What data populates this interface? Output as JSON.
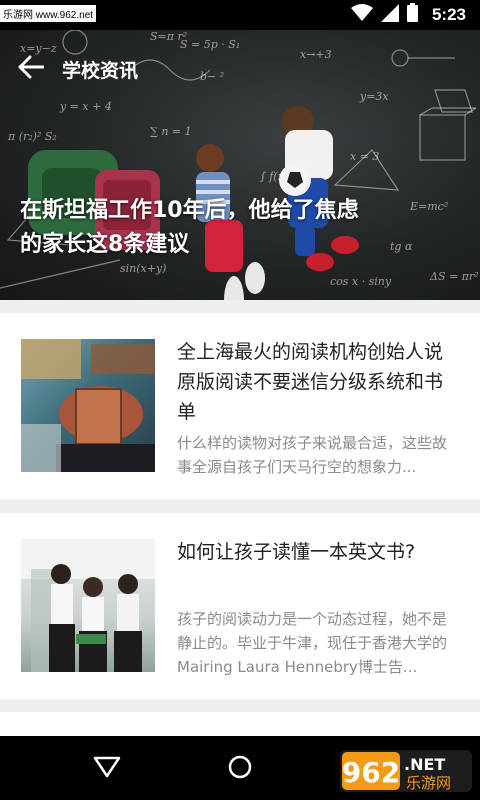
{
  "status_bar": {
    "watermark": "乐游网 www.962.net",
    "time": "5:23",
    "icons": [
      "wifi-icon",
      "signal-icon",
      "battery-icon"
    ]
  },
  "header": {
    "title": "学校资讯",
    "back_icon": "arrow-left-icon"
  },
  "banner": {
    "headline_line1": "在斯坦福工作10年后，他给了焦虑",
    "headline_line2": "的家长这8条建议",
    "chalk_texts": [
      "S=π r²",
      "x→+3",
      "b− ²",
      "y=3x",
      "x=y−z",
      "y = x + 4",
      "∑ n = 1",
      "x = 3",
      "E=mc²",
      "tg α",
      "sin(x+y)",
      "cos x · siny",
      "S = 5p · S₁",
      "∫ f(x)dx",
      "π (r₂)² S₂",
      "ΔS = πr²"
    ],
    "slide_count": 3,
    "active_slide": 1
  },
  "articles": [
    {
      "title": "全上海最火的阅读机构创始人说原版阅读不要迷信分级系统和书单",
      "summary": "什么样的读物对孩子来说最合适，这些故事全源自孩子们天马行空的想象力..."
    },
    {
      "title": "如何让孩子读懂一本英文书?",
      "summary": "孩子的阅读动力是一个动态过程，她不是静止的。毕业于牛津，现任于香港大学的Mairing Laura Hennebry博士告..."
    }
  ],
  "nav_bar": {
    "buttons": [
      "back-triangle-icon",
      "home-circle-icon"
    ],
    "watermark_digits": "962",
    "watermark_suffix": ".NET",
    "watermark_cn": "乐游网"
  },
  "colors": {
    "accent_orange": "#f39a16",
    "text_dark": "#222222",
    "text_gray": "#8a8a8a",
    "background": "#efefef"
  }
}
